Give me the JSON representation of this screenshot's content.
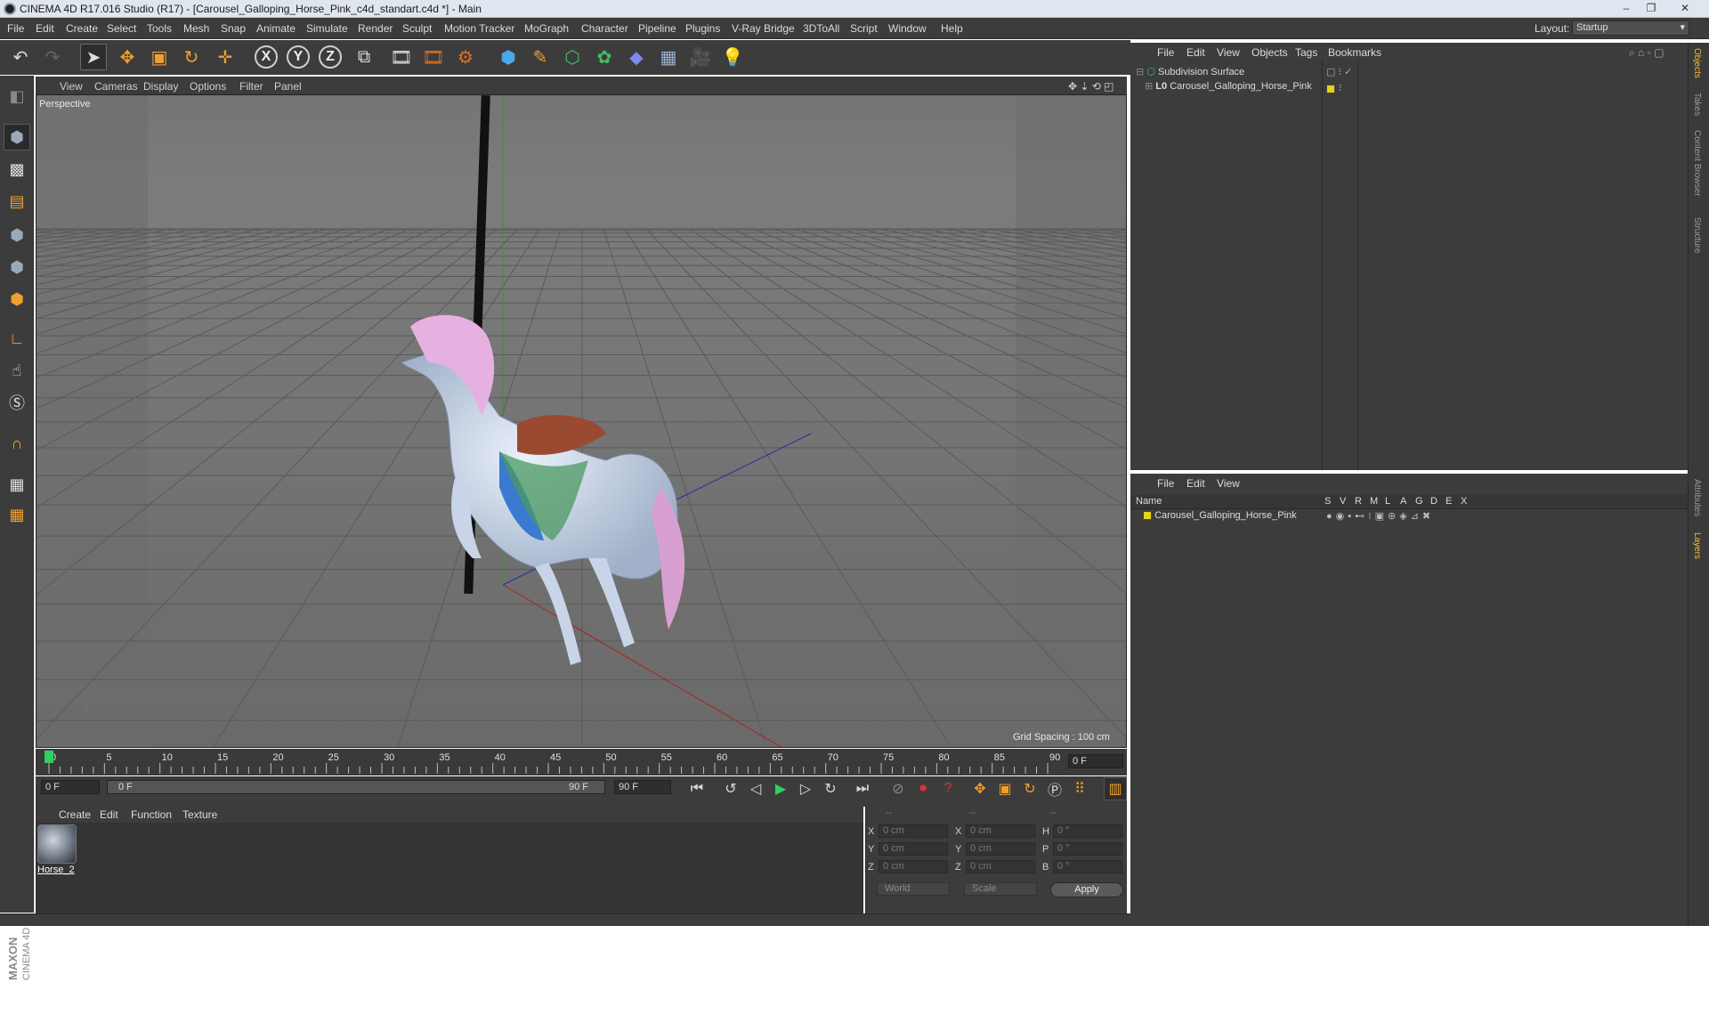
{
  "window": {
    "title": "CINEMA 4D R17.016 Studio (R17) - [Carousel_Galloping_Horse_Pink_c4d_standart.c4d *] - Main"
  },
  "menu": [
    "File",
    "Edit",
    "Create",
    "Select",
    "Tools",
    "Mesh",
    "Snap",
    "Animate",
    "Simulate",
    "Render",
    "Sculpt",
    "Motion Tracker",
    "MoGraph",
    "Character",
    "Pipeline",
    "Plugins",
    "V-Ray Bridge",
    "3DToAll",
    "Script",
    "Window",
    "Help"
  ],
  "layout": {
    "label": "Layout:",
    "value": "Startup"
  },
  "toolbar": {
    "axis_x": "X",
    "axis_y": "Y",
    "axis_z": "Z"
  },
  "viewport": {
    "menu": [
      "View",
      "Cameras",
      "Display",
      "Options",
      "Filter",
      "Panel"
    ],
    "label": "Perspective",
    "grid_spacing": "Grid Spacing : 100 cm"
  },
  "timeline": {
    "ticks": [
      "0",
      "5",
      "10",
      "15",
      "20",
      "25",
      "30",
      "35",
      "40",
      "45",
      "50",
      "55",
      "60",
      "65",
      "70",
      "75",
      "80",
      "85",
      "90"
    ],
    "end_field": "0 F",
    "start_field": "0 F",
    "range_start": "0 F",
    "range_end": "90 F",
    "max_field": "90 F"
  },
  "materials": {
    "menu": [
      "Create",
      "Edit",
      "Function",
      "Texture"
    ],
    "items": [
      {
        "name": "Horse_2"
      }
    ]
  },
  "coordinates": {
    "header": [
      "--",
      "--",
      "--"
    ],
    "rows": [
      {
        "a": "X",
        "av": "0 cm",
        "b": "X",
        "bv": "0 cm",
        "c": "H",
        "cv": "0 °"
      },
      {
        "a": "Y",
        "av": "0 cm",
        "b": "Y",
        "bv": "0 cm",
        "c": "P",
        "cv": "0 °"
      },
      {
        "a": "Z",
        "av": "0 cm",
        "b": "Z",
        "bv": "0 cm",
        "c": "B",
        "cv": "0 °"
      }
    ],
    "mode": "World",
    "scale": "Scale",
    "apply": "Apply"
  },
  "object_manager": {
    "menu": [
      "File",
      "Edit",
      "View",
      "Objects",
      "Tags",
      "Bookmarks"
    ],
    "objects": [
      {
        "name": "Subdivision Surface",
        "prefix": ""
      },
      {
        "name": "Carousel_Galloping_Horse_Pink",
        "prefix": "L0"
      }
    ]
  },
  "layer_manager": {
    "menu": [
      "File",
      "Edit",
      "View"
    ],
    "columns": [
      "Name",
      "S",
      "V",
      "R",
      "M",
      "L",
      "A",
      "G",
      "D",
      "E",
      "X"
    ],
    "layers": [
      {
        "name": "Carousel_Galloping_Horse_Pink",
        "color": "#e6d21a"
      }
    ]
  },
  "right_tabs": [
    "Objects",
    "Takes",
    "Content Browser",
    "Structure",
    "Attributes",
    "Layers"
  ],
  "branding": {
    "company": "MAXON",
    "product": "CINEMA 4D"
  }
}
